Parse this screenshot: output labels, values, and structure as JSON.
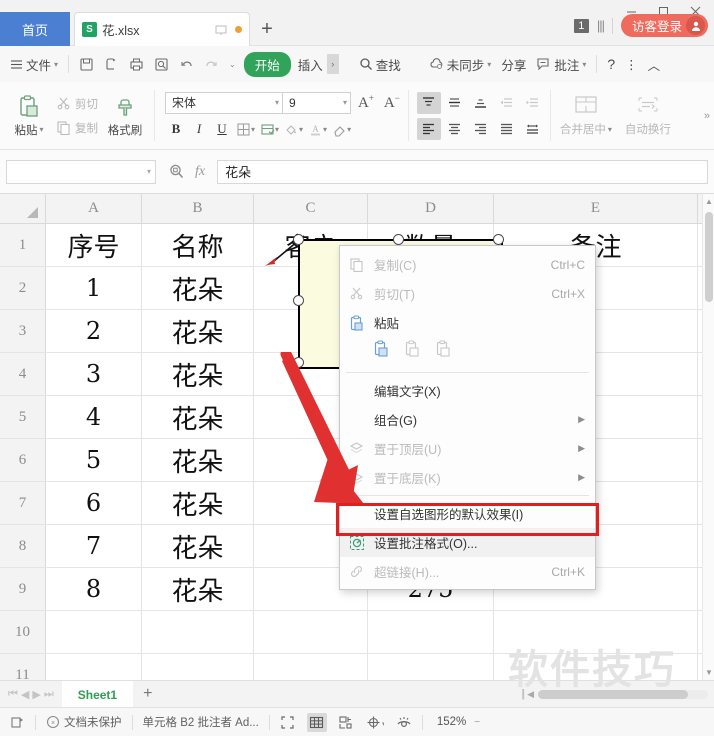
{
  "titlebar": {
    "home_tab": "首页",
    "doc_tab": {
      "name": "花.xlsx",
      "badge": "S"
    },
    "new_tab": "+",
    "count_badge": "1",
    "guest_login": "访客登录",
    "window": {
      "minimize": "—",
      "maximize": "▫",
      "close": "✕"
    }
  },
  "menubar": {
    "file": "文件",
    "start_tab": "开始",
    "insert_tab": "插入",
    "find": "查找",
    "sync": "未同步",
    "share": "分享",
    "comment": "批注",
    "help": "?",
    "more": "⋮",
    "collapse": "︿"
  },
  "ribbon": {
    "paste": "粘贴",
    "cut": "剪切",
    "copy": "复制",
    "format_painter": "格式刷",
    "font_name": "宋体",
    "font_size": "9",
    "grow_font": "A",
    "shrink_font": "A",
    "bold": "B",
    "italic": "I",
    "underline": "U",
    "merge_center": "合并居中",
    "wrap_text": "自动换行"
  },
  "formulabar": {
    "namebox_value": "",
    "formula_value": "花朵",
    "fx_label": "fx"
  },
  "grid": {
    "columns": [
      "A",
      "B",
      "C",
      "D",
      "E"
    ],
    "rows": [
      {
        "num": "1",
        "a": "序号",
        "b": "名称",
        "c": "客户",
        "d": "数量",
        "e": "备注"
      },
      {
        "num": "2",
        "a": "1",
        "b": "花朵",
        "c": "",
        "d": "",
        "e": ""
      },
      {
        "num": "3",
        "a": "2",
        "b": "花朵",
        "c": "",
        "d": "",
        "e": ""
      },
      {
        "num": "4",
        "a": "3",
        "b": "花朵",
        "c": "",
        "d": "",
        "e": ""
      },
      {
        "num": "5",
        "a": "4",
        "b": "花朵",
        "c": "",
        "d": "",
        "e": ""
      },
      {
        "num": "6",
        "a": "5",
        "b": "花朵",
        "c": "",
        "d": "",
        "e": ""
      },
      {
        "num": "7",
        "a": "6",
        "b": "花朵",
        "c": "",
        "d": "",
        "e": ""
      },
      {
        "num": "8",
        "a": "7",
        "b": "花朵",
        "c": "",
        "d": "",
        "e": ""
      },
      {
        "num": "9",
        "a": "8",
        "b": "花朵",
        "c": "",
        "d": "275",
        "e": ""
      },
      {
        "num": "10",
        "a": "",
        "b": "",
        "c": "",
        "d": "",
        "e": ""
      },
      {
        "num": "11",
        "a": "",
        "b": "",
        "c": "",
        "d": "",
        "e": ""
      }
    ]
  },
  "context_menu": {
    "items": [
      {
        "label": "复制(C)",
        "shortcut": "Ctrl+C",
        "disabled": true,
        "icon": "copy-icon"
      },
      {
        "label": "剪切(T)",
        "shortcut": "Ctrl+X",
        "disabled": true,
        "icon": "cut-icon"
      },
      {
        "label": "粘贴",
        "shortcut": "",
        "disabled": false,
        "icon": "paste-icon"
      },
      {
        "label": "编辑文字(X)",
        "shortcut": "",
        "disabled": false,
        "icon": ""
      },
      {
        "label": "组合(G)",
        "shortcut": "",
        "disabled": false,
        "icon": "",
        "submenu": true
      },
      {
        "label": "置于顶层(U)",
        "shortcut": "",
        "disabled": true,
        "icon": "bring-front-icon",
        "submenu": true
      },
      {
        "label": "置于底层(K)",
        "shortcut": "",
        "disabled": true,
        "icon": "send-back-icon",
        "submenu": true
      },
      {
        "label": "设置自选图形的默认效果(I)",
        "shortcut": "",
        "disabled": false,
        "icon": ""
      },
      {
        "label": "设置批注格式(O)...",
        "shortcut": "",
        "disabled": false,
        "icon": "format-comment-icon",
        "highlighted": true
      },
      {
        "label": "超链接(H)...",
        "shortcut": "Ctrl+K",
        "disabled": true,
        "icon": "link-icon"
      }
    ]
  },
  "sheetbar": {
    "sheet_name": "Sheet1",
    "add_sheet": "+"
  },
  "statusbar": {
    "protection": "文档未保护",
    "cell_info": "单元格 B2 批注者 Ad...",
    "zoom": "152%"
  },
  "watermark": "软件技巧",
  "colors": {
    "accent_green": "#32a35a",
    "home_blue": "#4b7fd1",
    "guest_red": "#ef6b5e",
    "highlight_red": "#e02020",
    "comment_yellow": "#fbfbdf"
  }
}
